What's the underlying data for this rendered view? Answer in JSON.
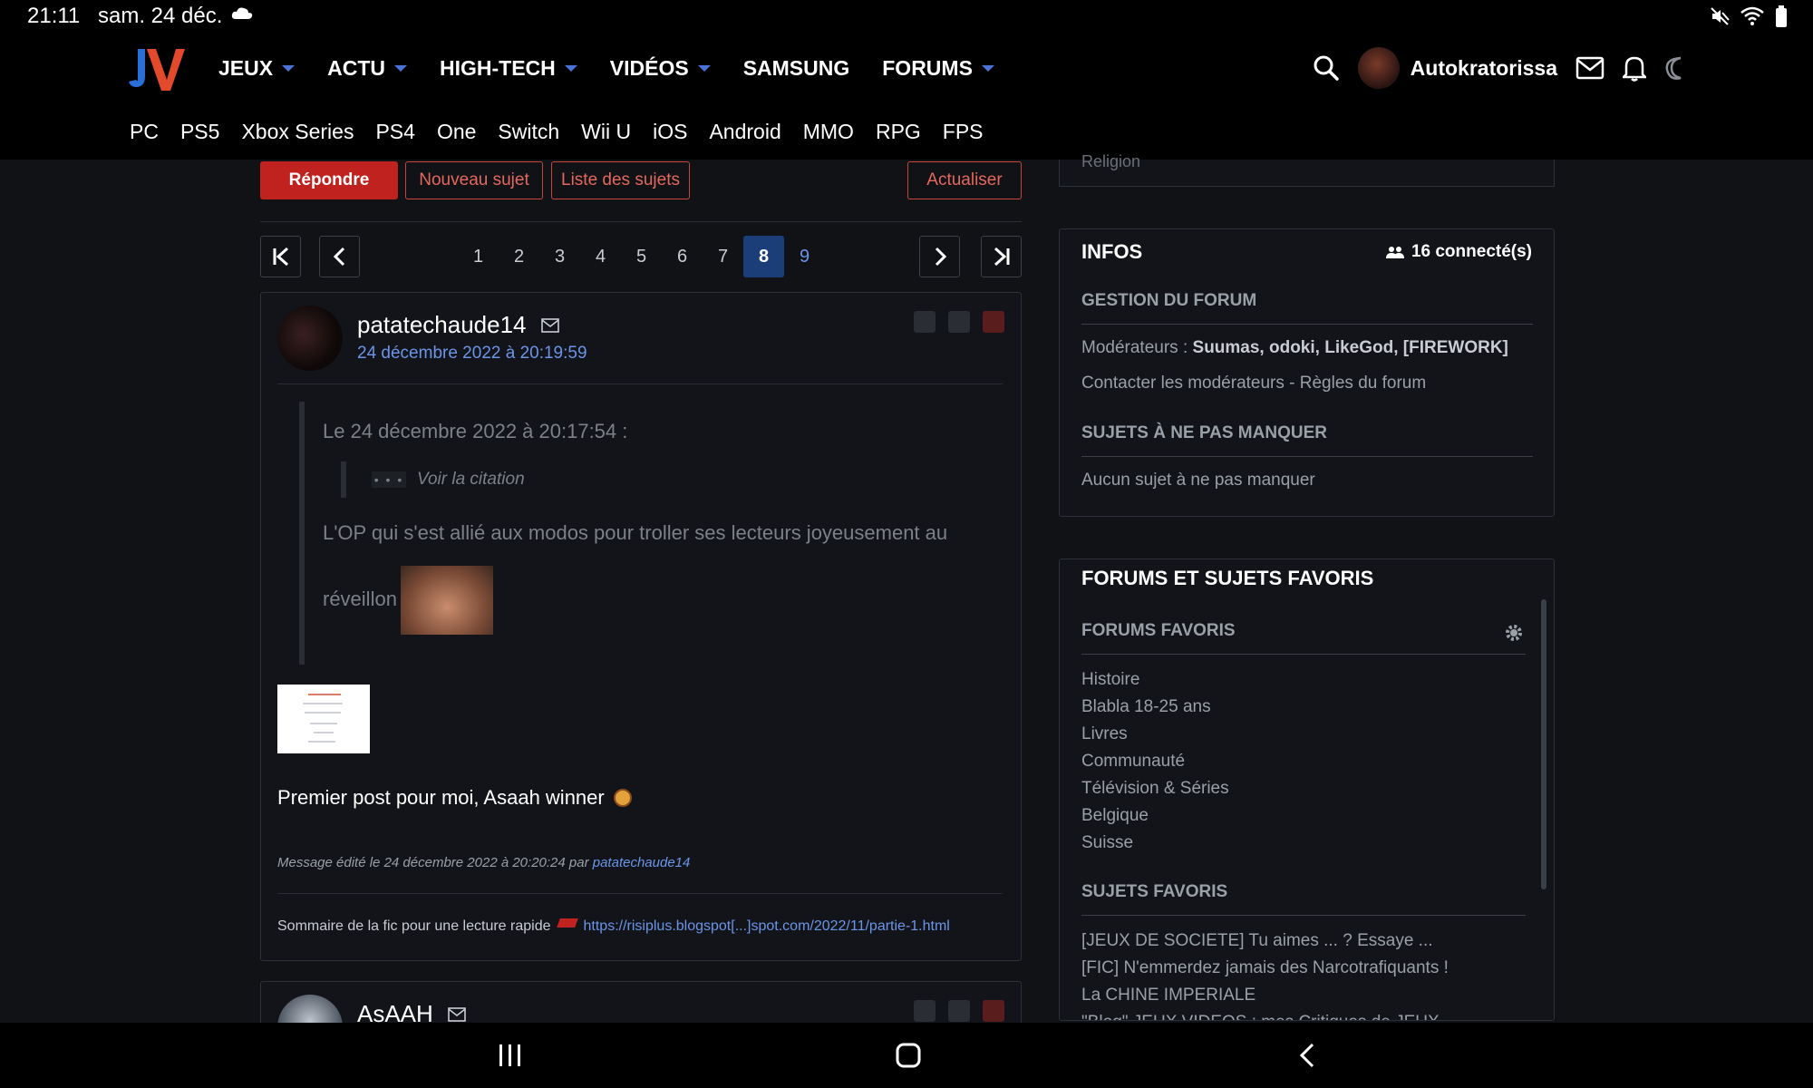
{
  "status_bar": {
    "time": "21:11",
    "date": "sam. 24 déc."
  },
  "main_menu": [
    {
      "label": "JEUX",
      "has_caret": true
    },
    {
      "label": "ACTU",
      "has_caret": true
    },
    {
      "label": "HIGH-TECH",
      "has_caret": true
    },
    {
      "label": "VIDÉOS",
      "has_caret": true
    },
    {
      "label": "SAMSUNG",
      "has_caret": false
    },
    {
      "label": "FORUMS",
      "has_caret": true
    }
  ],
  "user": {
    "name": "Autokratorissa"
  },
  "sub_menu": [
    "PC",
    "PS5",
    "Xbox Series",
    "PS4",
    "One",
    "Switch",
    "Wii U",
    "iOS",
    "Android",
    "MMO",
    "RPG",
    "FPS"
  ],
  "toolbar": {
    "reply": "Répondre",
    "new_topic": "Nouveau sujet",
    "topic_list": "Liste des sujets",
    "refresh": "Actualiser"
  },
  "pagination": {
    "pages": [
      "1",
      "2",
      "3",
      "4",
      "5",
      "6",
      "7",
      "8",
      "9"
    ],
    "current": "8"
  },
  "post": {
    "author": "patatechaude14",
    "date": "24 décembre 2022 à 20:19:59",
    "quote_header": "Le 24 décembre 2022 à 20:17:54 :",
    "nested_quote_dots": "• • •",
    "nested_quote_link": "Voir la citation",
    "quote_text_line1": "L'OP qui s'est allié aux modos pour troller ses lecteurs joyeusement au",
    "quote_text_line2": "réveillon",
    "body": "Premier post pour moi, Asaah winner",
    "edited_prefix": "Message édité le 24 décembre 2022 à 20:20:24 par",
    "edited_by": "patatechaude14",
    "signature_text": "Sommaire de la fic pour une lecture rapide",
    "signature_link": "https://risiplus.blogspot[...]spot.com/2022/11/partie-1.html"
  },
  "post2": {
    "author": "AsAAH"
  },
  "sidebar": {
    "top_cut": "Religion",
    "infos": {
      "title": "INFOS",
      "connected": "16 connecté(s)",
      "forum_management": "GESTION DU FORUM",
      "moderators_label": "Modérateurs :",
      "moderators": "Suumas, odoki, LikeGod, [FIREWORK]",
      "contact_line": "Contacter les modérateurs - Règles du forum",
      "must_see_title": "SUJETS À NE PAS MANQUER",
      "must_see_empty": "Aucun sujet à ne pas manquer"
    },
    "favorites": {
      "title": "FORUMS ET SUJETS FAVORIS",
      "forums_title": "FORUMS FAVORIS",
      "forums": [
        "Histoire",
        "Blabla 18-25 ans",
        "Livres",
        "Communauté",
        "Télévision & Séries",
        "Belgique",
        "Suisse"
      ],
      "topics_title": "SUJETS FAVORIS",
      "topics": [
        "[JEUX DE SOCIETE] Tu aimes ... ? Essaye ...",
        "[FIC] N'emmerdez jamais des Narcotrafiquants !",
        "La CHINE IMPERIALE",
        "\"Blog\" JEUX VIDEOS : mes Critiques de JEUX"
      ]
    }
  },
  "colors": {
    "accent_red": "#c0231f",
    "link_blue": "#6a95e8",
    "current_page": "#1b3d78"
  }
}
